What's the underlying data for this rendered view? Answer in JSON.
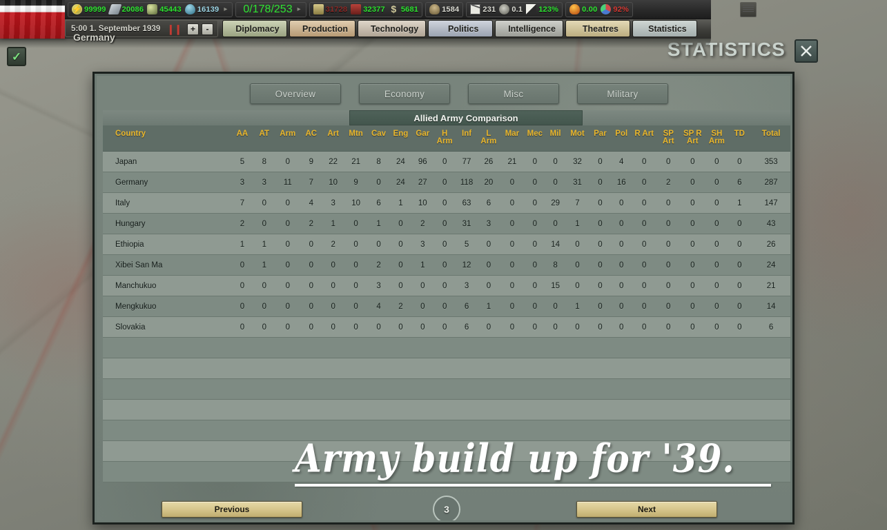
{
  "topbar": {
    "flag_name": "germany-flag",
    "resources": [
      {
        "icon": "energy-icon",
        "value": "99999",
        "color": "green"
      },
      {
        "icon": "metal-icon",
        "value": "20086",
        "color": "green"
      },
      {
        "icon": "rare-materials-icon",
        "value": "45443",
        "color": "green"
      },
      {
        "icon": "crude-oil-icon",
        "value": "16139",
        "color": "lightblue"
      }
    ],
    "industry": {
      "icon": "factory-icon",
      "value": "0/178/253",
      "color": "green"
    },
    "stockpile": [
      {
        "icon": "supplies-icon",
        "value": "31728",
        "color": "red"
      },
      {
        "icon": "fuel-icon",
        "value": "32377",
        "color": "green"
      },
      {
        "icon": "money-icon",
        "value": "5681",
        "color": "green"
      }
    ],
    "status": [
      {
        "icon": "manpower-icon",
        "value": "1584",
        "color": "white"
      },
      {
        "icon": "mail-icon",
        "value": "231",
        "color": "white"
      },
      {
        "icon": "dissent-icon",
        "value": "0.1",
        "color": "white"
      },
      {
        "icon": "national-unity-icon",
        "value": "123%",
        "color": "green"
      },
      {
        "icon": "dissent-flame-icon",
        "value": "0.00",
        "color": "green"
      },
      {
        "icon": "intelligence-icon",
        "value": "92%",
        "color": "red2"
      }
    ],
    "ledger_icon": "ledger-icon",
    "date": "5:00 1. September 1939",
    "country": "Germany",
    "pause_icon": "pause-icon",
    "speed_up": "+",
    "speed_down": "-",
    "menu_tabs": [
      {
        "label": "Diplomacy",
        "cls": "t-diplomacy",
        "icon": "diplomacy-icon"
      },
      {
        "label": "Production",
        "cls": "t-production",
        "icon": "production-icon"
      },
      {
        "label": "Technology",
        "cls": "t-technology",
        "icon": "technology-icon"
      },
      {
        "label": "Politics",
        "cls": "t-politics",
        "icon": "politics-icon"
      },
      {
        "label": "Intelligence",
        "cls": "t-intelligence",
        "icon": "intelligence-icon"
      },
      {
        "label": "Theatres",
        "cls": "t-theatres",
        "icon": "theatres-icon"
      },
      {
        "label": "Statistics",
        "cls": "t-statistics",
        "icon": "statistics-icon"
      }
    ]
  },
  "window": {
    "title": "STATISTICS",
    "close_icon": "close-icon",
    "check_icon": "checkmark-icon"
  },
  "subtabs": [
    {
      "label": "Overview"
    },
    {
      "label": "Economy"
    },
    {
      "label": "Misc"
    },
    {
      "label": "Military"
    }
  ],
  "section": {
    "title": "Allied Army Comparison"
  },
  "overlay": {
    "text": "Army build up for '39."
  },
  "footer": {
    "previous": "Previous",
    "next": "Next",
    "page": "3"
  },
  "ghost_text": "",
  "chart_data": {
    "type": "table",
    "title": "Allied Army Comparison",
    "columns": [
      "Country",
      "AA",
      "AT",
      "Arm",
      "AC",
      "Art",
      "Mtn",
      "Cav",
      "Eng",
      "Gar",
      "H Arm",
      "Inf",
      "L Arm",
      "Mar",
      "Mec",
      "Mil",
      "Mot",
      "Par",
      "Pol",
      "R Art",
      "SP Art",
      "SP R Art",
      "SH Arm",
      "TD",
      "Total"
    ],
    "rows": [
      {
        "country": "Japan",
        "values": [
          5,
          8,
          0,
          9,
          22,
          21,
          8,
          24,
          96,
          0,
          77,
          26,
          21,
          0,
          0,
          32,
          0,
          4,
          0,
          0,
          0,
          0,
          0,
          353
        ]
      },
      {
        "country": "Germany",
        "values": [
          3,
          3,
          11,
          7,
          10,
          9,
          0,
          24,
          27,
          0,
          118,
          20,
          0,
          0,
          0,
          31,
          0,
          16,
          0,
          2,
          0,
          0,
          6,
          287
        ]
      },
      {
        "country": "Italy",
        "values": [
          7,
          0,
          0,
          4,
          3,
          10,
          6,
          1,
          10,
          0,
          63,
          6,
          0,
          0,
          29,
          7,
          0,
          0,
          0,
          0,
          0,
          0,
          1,
          147
        ]
      },
      {
        "country": "Hungary",
        "values": [
          2,
          0,
          0,
          2,
          1,
          0,
          1,
          0,
          2,
          0,
          31,
          3,
          0,
          0,
          0,
          1,
          0,
          0,
          0,
          0,
          0,
          0,
          0,
          43
        ]
      },
      {
        "country": "Ethiopia",
        "values": [
          1,
          1,
          0,
          0,
          2,
          0,
          0,
          0,
          3,
          0,
          5,
          0,
          0,
          0,
          14,
          0,
          0,
          0,
          0,
          0,
          0,
          0,
          0,
          26
        ]
      },
      {
        "country": "Xibei San Ma",
        "values": [
          0,
          1,
          0,
          0,
          0,
          0,
          2,
          0,
          1,
          0,
          12,
          0,
          0,
          0,
          8,
          0,
          0,
          0,
          0,
          0,
          0,
          0,
          0,
          24
        ]
      },
      {
        "country": "Manchukuo",
        "values": [
          0,
          0,
          0,
          0,
          0,
          0,
          3,
          0,
          0,
          0,
          3,
          0,
          0,
          0,
          15,
          0,
          0,
          0,
          0,
          0,
          0,
          0,
          0,
          21
        ]
      },
      {
        "country": "Mengkukuo",
        "values": [
          0,
          0,
          0,
          0,
          0,
          0,
          4,
          2,
          0,
          0,
          6,
          1,
          0,
          0,
          0,
          1,
          0,
          0,
          0,
          0,
          0,
          0,
          0,
          14
        ]
      },
      {
        "country": "Slovakia",
        "values": [
          0,
          0,
          0,
          0,
          0,
          0,
          0,
          0,
          0,
          0,
          6,
          0,
          0,
          0,
          0,
          0,
          0,
          0,
          0,
          0,
          0,
          0,
          0,
          6
        ]
      }
    ],
    "blank_rows": 7
  }
}
